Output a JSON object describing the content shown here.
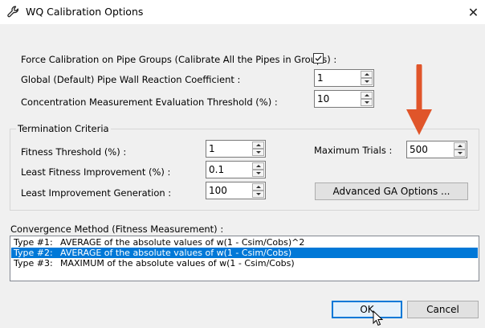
{
  "window": {
    "title": "WQ Calibration Options",
    "icon": "wrench-icon",
    "close_glyph": "✕"
  },
  "options": {
    "force_calibration": {
      "label": "Force Calibration on Pipe Groups (Calibrate All the Pipes in Groups) :",
      "checked": true
    },
    "wall_reaction": {
      "label": "Global (Default) Pipe Wall Reaction Coefficient :",
      "value": "1"
    },
    "concentration_threshold": {
      "label": "Concentration Measurement Evaluation Threshold (%) :",
      "value": "10"
    }
  },
  "termination": {
    "title": "Termination Criteria",
    "fitness_threshold": {
      "label": "Fitness Threshold (%) :",
      "value": "1"
    },
    "least_fitness_improvement": {
      "label": "Least Fitness Improvement (%) :",
      "value": "0.1"
    },
    "least_improvement_generation": {
      "label": "Least Improvement Generation :",
      "value": "100"
    },
    "maximum_trials": {
      "label": "Maximum Trials :",
      "value": "500"
    },
    "advanced_button": "Advanced GA Options ..."
  },
  "convergence": {
    "title": "Convergence Method (Fitness Measurement) :",
    "items": [
      {
        "type": "Type #1:",
        "desc": "AVERAGE of the absolute values of w(1 - Csim/Cobs)^2",
        "selected": false
      },
      {
        "type": "Type #2:",
        "desc": "AVERAGE of the absolute values of w(1 - Csim/Cobs)",
        "selected": true
      },
      {
        "type": "Type #3:",
        "desc": "MAXIMUM of the absolute values of w(1 - Csim/Cobs)",
        "selected": false
      }
    ]
  },
  "footer": {
    "ok_label": "OK",
    "cancel_label": "Cancel"
  },
  "colors": {
    "selection": "#0078d7",
    "annotation_arrow": "#e0552a",
    "window_bg": "#f0f0f0"
  }
}
